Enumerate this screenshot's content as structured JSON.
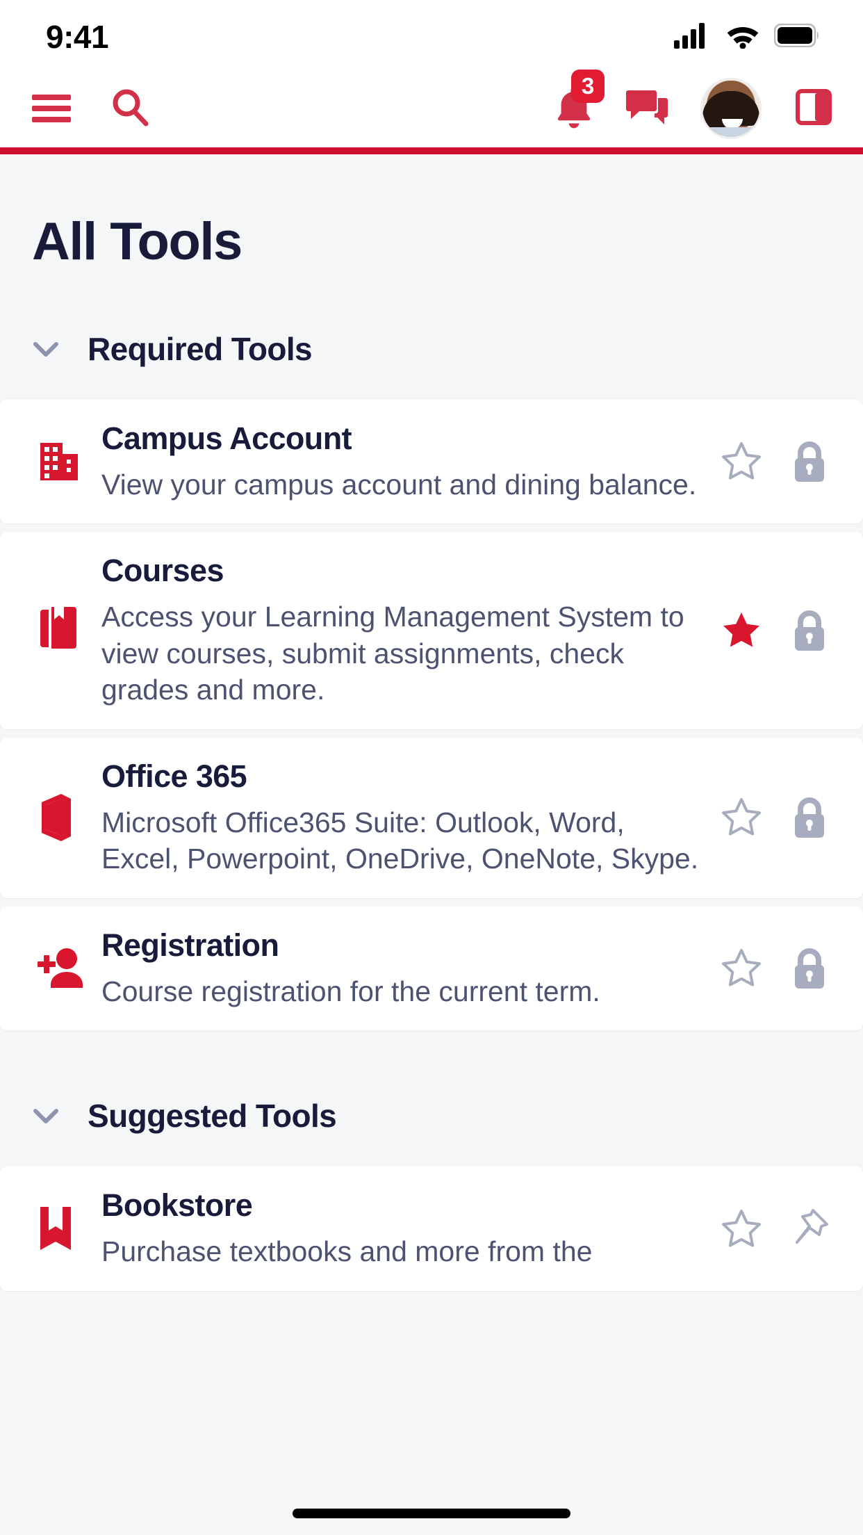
{
  "status_bar": {
    "time": "9:41",
    "icons": [
      "cellular-signal-icon",
      "wifi-icon",
      "battery-icon"
    ]
  },
  "header": {
    "menu_icon": "hamburger-menu-icon",
    "search_icon": "search-icon",
    "notifications_icon": "bell-icon",
    "notifications_count": "3",
    "messages_icon": "chat-bubble-icon",
    "avatar": "user-avatar",
    "panel_icon": "side-panel-icon",
    "accent_color": "#D23049",
    "brand_bar_color": "#CE0E2D"
  },
  "page": {
    "title": "All Tools",
    "title_color": "#181C3A",
    "background_color": "#F4F6F8"
  },
  "sections": [
    {
      "label": "Required Tools",
      "chevron": "chevron-down-icon",
      "expanded": true,
      "tools": [
        {
          "name": "Campus Account",
          "description": "View your campus account and dining balance.",
          "icon": "building-icon",
          "icon_color": "#D8172F",
          "favorite": false,
          "favorite_icon": "star-outline-icon",
          "status_icon": "lock-icon"
        },
        {
          "name": "Courses",
          "description": "Access your Learning Management System to view courses, submit assignments, check grades and more.",
          "icon": "book-bookmark-icon",
          "icon_color": "#D8172F",
          "favorite": true,
          "favorite_icon": "star-filled-icon",
          "status_icon": "lock-icon"
        },
        {
          "name": "Office 365",
          "description": "Microsoft Office365 Suite: Outlook, Word, Excel, Powerpoint, OneDrive, OneNote, Skype.",
          "icon": "office-365-icon",
          "icon_color": "#D8172F",
          "favorite": false,
          "favorite_icon": "star-outline-icon",
          "status_icon": "lock-icon"
        },
        {
          "name": "Registration",
          "description": "Course registration for the current term.",
          "icon": "person-add-icon",
          "icon_color": "#D8172F",
          "favorite": false,
          "favorite_icon": "star-outline-icon",
          "status_icon": "lock-icon"
        }
      ]
    },
    {
      "label": "Suggested Tools",
      "chevron": "chevron-down-icon",
      "expanded": true,
      "tools": [
        {
          "name": "Bookstore",
          "description": "Purchase textbooks and more from the",
          "icon": "open-book-icon",
          "icon_color": "#D8172F",
          "favorite": false,
          "favorite_icon": "star-outline-icon",
          "status_icon": "pin-outline-icon"
        }
      ]
    }
  ],
  "colors": {
    "accent_red": "#D23049",
    "icon_red": "#D8172F",
    "brand_red": "#CE0E2D",
    "navy": "#181C3A",
    "body_text": "#4D5270",
    "muted_gray": "#9AA0B4",
    "card_white": "#FFFFFF",
    "page_bg": "#F4F6F8"
  }
}
